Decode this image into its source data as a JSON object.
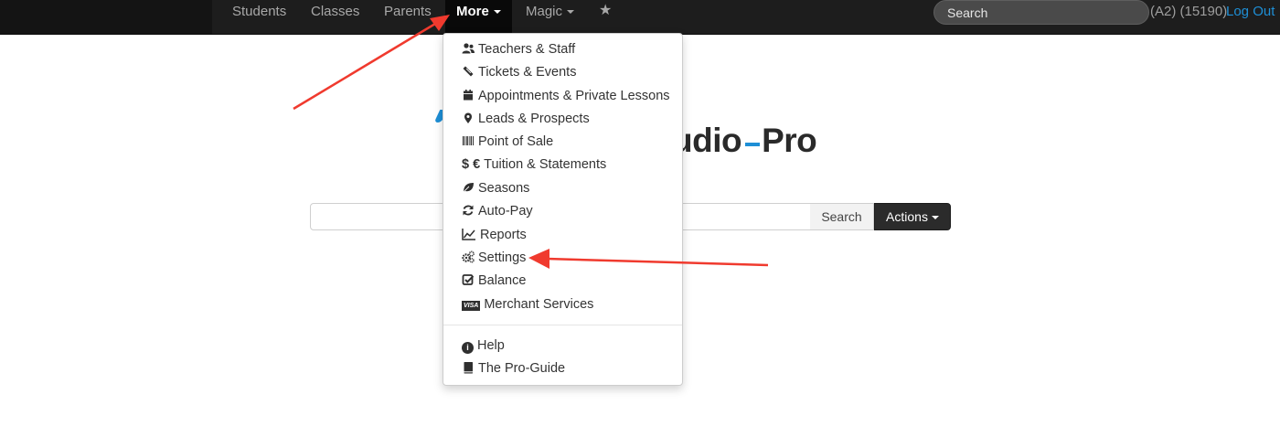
{
  "navbar": {
    "items": [
      {
        "label": "Students"
      },
      {
        "label": "Classes"
      },
      {
        "label": "Parents"
      },
      {
        "label": "More"
      },
      {
        "label": "Magic"
      }
    ],
    "star_icon": "star-icon",
    "search_placeholder": "Search",
    "account_code": "(A2) (15190)",
    "logout_label": "Log Out"
  },
  "logo": {
    "text_left": "udio",
    "text_right": "Pro"
  },
  "search": {
    "value": "",
    "button_label": "Search",
    "actions_label": "Actions"
  },
  "dropdown": {
    "items": [
      {
        "label": "Teachers & Staff",
        "icon": "users-icon"
      },
      {
        "label": "Tickets & Events",
        "icon": "ticket-icon"
      },
      {
        "label": "Appointments & Private Lessons",
        "icon": "calendar-icon"
      },
      {
        "label": "Leads & Prospects",
        "icon": "map-marker-icon"
      },
      {
        "label": "Point of Sale",
        "icon": "barcode-icon"
      },
      {
        "label": "Tuition & Statements",
        "icon": "currency-icon",
        "icon_text": "$ €"
      },
      {
        "label": "Seasons",
        "icon": "leaf-icon"
      },
      {
        "label": "Auto-Pay",
        "icon": "refresh-icon"
      },
      {
        "label": "Reports",
        "icon": "line-chart-icon"
      },
      {
        "label": "Settings",
        "icon": "cogs-icon"
      },
      {
        "label": "Balance",
        "icon": "check-square-icon"
      },
      {
        "label": "Merchant Services",
        "icon": "visa-card-icon",
        "icon_text": "VISA"
      }
    ],
    "help_items": [
      {
        "label": "Help",
        "icon": "info-circle-icon",
        "icon_text": "i"
      },
      {
        "label": "The Pro-Guide",
        "icon": "book-icon"
      }
    ]
  },
  "colors": {
    "navbar_bg": "#1d1d1d",
    "accent": "#1e8fd6",
    "annotation_red": "#f03a2e"
  }
}
